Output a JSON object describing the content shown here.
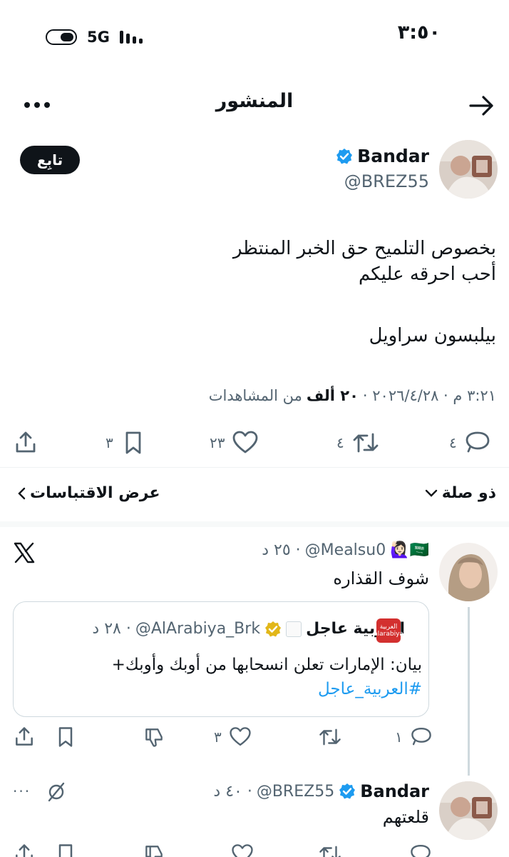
{
  "status_bar": {
    "time": "٣:٥٠",
    "network": "5G"
  },
  "header": {
    "title": "المنشور"
  },
  "main_tweet": {
    "name": "Bandar",
    "handle": "@BREZ55",
    "follow_label": "تابِع",
    "text_line1": "بخصوص التلميح حق الخبر المنتظر",
    "text_line2": "أحب احرقه عليكم",
    "text_line3": "بيلبسون سراويل",
    "timestamp": "٣:٢١ م · ٢٠٢٦/٤/٢٨ ·",
    "views_count": "٢٠ ألف",
    "views_label": "من المشاهدات",
    "replies": "٤",
    "reposts": "٤",
    "likes": "٢٣",
    "bookmarks": "٣"
  },
  "filter": {
    "related_label": "ذو صلة",
    "quotes_label": "عرض الاقتباسات"
  },
  "reply1": {
    "flags": "🇸🇦🙋🏻‍♀️",
    "handle": "@Mealsu0",
    "time": "· ٢٥ د",
    "text": "شوف القذاره",
    "quote": {
      "name": "العربية عاجل",
      "handle": "@AlArabiya_Brk",
      "time": "· ٢٨ د",
      "logo_text": "العربية alarabiya",
      "text": "بيان: الإمارات تعلن انسحابها من أوبك وأوبك+",
      "hashtag": "#العربية_عاجل"
    },
    "replies": "١",
    "likes": "٣"
  },
  "reply2": {
    "name": "Bandar",
    "handle": "@BREZ55",
    "time": "· ٤٠ د",
    "text": "قلعتهم",
    "more": "···"
  },
  "colors": {
    "verified": "#1d9bf0",
    "muted": "#536471",
    "brand_logo": "#d3302f"
  },
  "icons": [
    "back-arrow-icon",
    "more-icon",
    "verified-icon",
    "reply-icon",
    "repost-icon",
    "like-icon",
    "bookmark-icon",
    "share-icon",
    "x-logo-icon",
    "dislike-icon",
    "mute-icon",
    "chevron-down-icon",
    "chevron-left-icon"
  ]
}
